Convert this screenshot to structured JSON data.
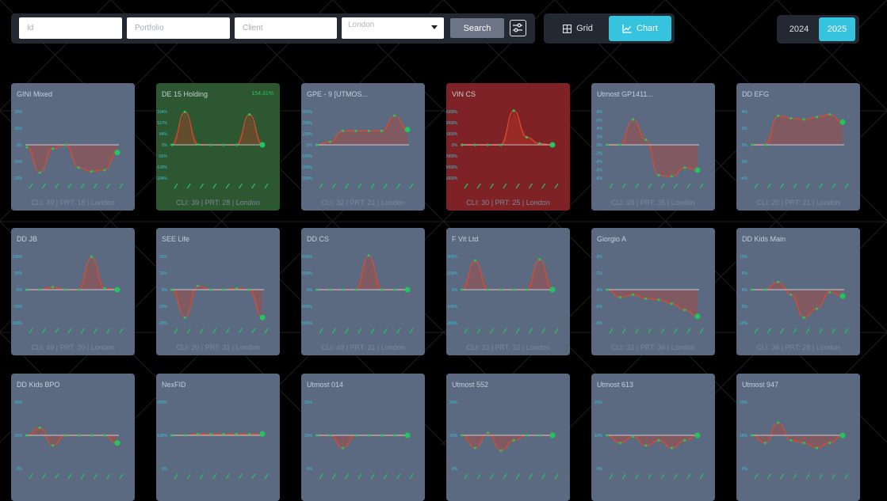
{
  "filters": {
    "id_placeholder": "Id",
    "portfolio_placeholder": "Portfolio",
    "client_placeholder": "Client",
    "location_value": "London",
    "search_label": "Search"
  },
  "view_toggle": {
    "grid_label": "Grid",
    "chart_label": "Chart",
    "active": "chart"
  },
  "year_toggle": {
    "years": [
      "2024",
      "2025"
    ],
    "active": "2025"
  },
  "colors": {
    "accent": "#36c3dd",
    "card_default": "#5b6a80",
    "card_positive": "#2c5730",
    "card_negative": "#7e2226",
    "line": "#e24a2b",
    "point": "#22c55e"
  },
  "cards": [
    {
      "title": "GINI Mixed",
      "perf": "",
      "footer": "CLI: 49 | PRT: 18 | London",
      "status": "neutral",
      "y_ticks": [
        "20%",
        "10%",
        "0%",
        "-10%",
        "-20%"
      ],
      "values": [
        -0.1,
        -1.1,
        -0.15,
        0,
        -0.9,
        -1.05,
        -1.0,
        -0.3
      ]
    },
    {
      "title": "DE 15 Holding",
      "perf": "154.31%",
      "footer": "CLI: 39 | PRT: 28 | London",
      "status": "positive",
      "y_ticks": [
        "334%",
        "167%",
        "84%",
        "0%",
        "-50%",
        "-100%",
        "-334%"
      ],
      "values": [
        0,
        1.3,
        0.01,
        0,
        0,
        0,
        1.2,
        0
      ]
    },
    {
      "title": "GPE - 9 [UTMOS...",
      "perf": "",
      "footer": "CLI: 32 | PRT: 21 | London",
      "status": "neutral",
      "y_ticks": [
        "300%",
        "200%",
        "100%",
        "0%",
        "-100%",
        "-200%",
        "-300%"
      ],
      "values": [
        0,
        0.12,
        0.55,
        0.55,
        0.55,
        0.55,
        1.15,
        0.6
      ]
    },
    {
      "title": "VIN CS",
      "perf": "",
      "footer": "CLI: 30 | PRT: 25 | London",
      "status": "negative",
      "y_ticks": [
        "6000%",
        "4000%",
        "2000%",
        "0%",
        "-2000%",
        "-4000%",
        "-6000%"
      ],
      "values": [
        0,
        0,
        0,
        0,
        1.35,
        0.3,
        0.05,
        0
      ]
    },
    {
      "title": "Utmost GP1411...",
      "perf": "",
      "footer": "CLI: 28 | PRT: 35 | London",
      "status": "neutral",
      "y_ticks": [
        "8%",
        "6%",
        "4%",
        "2%",
        "0%",
        "-2%",
        "-4%",
        "-6%",
        "-8%"
      ],
      "values": [
        0,
        0,
        1.0,
        0.2,
        -1.2,
        -1.25,
        -0.9,
        -1.0
      ]
    },
    {
      "title": "DD EFG",
      "perf": "",
      "footer": "CLI: 20 | PRT: 21 | London",
      "status": "neutral",
      "y_ticks": [
        "4%",
        "2%",
        "0%",
        "-2%",
        "-4%"
      ],
      "values": [
        0,
        0,
        1.15,
        1.05,
        1.0,
        1.1,
        1.2,
        0.9
      ]
    },
    {
      "title": "DD JB",
      "perf": "",
      "footer": "CLI: 49 | PRT: 30 | London",
      "status": "neutral",
      "y_ticks": [
        "100%",
        "50%",
        "0%",
        "-50%",
        "-100%"
      ],
      "values": [
        0,
        0,
        0.1,
        0,
        0,
        1.3,
        0.05,
        0
      ]
    },
    {
      "title": "SEE Life",
      "perf": "",
      "footer": "CLI: 20 | PRT: 31 | London",
      "status": "neutral",
      "y_ticks": [
        "20%",
        "10%",
        "0%",
        "-10%",
        "-20%"
      ],
      "values": [
        0,
        -1.1,
        0.15,
        0,
        0,
        0.05,
        0,
        -1.1
      ]
    },
    {
      "title": "DD CS",
      "perf": "",
      "footer": "CLI: 49 | PRT: 31 | London",
      "status": "neutral",
      "y_ticks": [
        "2000%",
        "1000%",
        "0%",
        "-1000%",
        "-2000%"
      ],
      "values": [
        0,
        0,
        0,
        0,
        1.35,
        0,
        0,
        0
      ]
    },
    {
      "title": "F Vit Ltd",
      "perf": "",
      "footer": "CLI: 33 | PRT: 32 | London",
      "status": "neutral",
      "y_ticks": [
        "200%",
        "100%",
        "0%",
        "-100%",
        "-200%"
      ],
      "values": [
        0,
        1.15,
        0,
        0,
        0,
        0,
        1.2,
        0
      ]
    },
    {
      "title": "Giorgio A",
      "perf": "",
      "footer": "CLI: 32 | PRT: 36 | London",
      "status": "neutral",
      "y_ticks": [
        "0%",
        "-2%",
        "-4%",
        "-6%",
        "-8%"
      ],
      "values": [
        0,
        -0.3,
        -0.2,
        -0.35,
        -0.4,
        -0.55,
        -0.8,
        -1.05
      ]
    },
    {
      "title": "DD Kids Main",
      "perf": "",
      "footer": "CLI: 36 | PRT: 28 | London",
      "status": "neutral",
      "y_ticks": [
        "10%",
        "5%",
        "0%",
        "-5%",
        "-10%"
      ],
      "values": [
        0,
        0,
        0.3,
        -0.2,
        -1.1,
        -0.75,
        -0.1,
        -0.25
      ]
    },
    {
      "title": "DD Kids BPO",
      "perf": "",
      "footer": "",
      "status": "neutral",
      "y_ticks": [
        "20%",
        "10%",
        "0%"
      ],
      "values": [
        0,
        0.3,
        -0.4,
        0,
        0,
        0,
        0,
        -0.3
      ]
    },
    {
      "title": "NexFID",
      "perf": "",
      "footer": "",
      "status": "neutral",
      "y_ticks": [
        "200%",
        "100%",
        "0%"
      ],
      "values": [
        0,
        0,
        0.05,
        0.05,
        0.05,
        0.05,
        0.05,
        0.05
      ]
    },
    {
      "title": "Utmost 014",
      "perf": "",
      "footer": "",
      "status": "neutral",
      "y_ticks": [
        "20%",
        "10%",
        "0%"
      ],
      "values": [
        0,
        0,
        -0.5,
        0,
        0,
        0,
        0,
        0
      ]
    },
    {
      "title": "Utmost 552",
      "perf": "",
      "footer": "",
      "status": "neutral",
      "y_ticks": [
        "20%",
        "10%",
        "0%"
      ],
      "values": [
        0,
        -0.5,
        0.1,
        -0.6,
        -0.2,
        0,
        0,
        0
      ]
    },
    {
      "title": "Utmost 613",
      "perf": "",
      "footer": "",
      "status": "neutral",
      "y_ticks": [
        "20%",
        "10%",
        "0%"
      ],
      "values": [
        0,
        -0.3,
        -0.05,
        -0.4,
        -0.2,
        -0.5,
        -0.2,
        0
      ]
    },
    {
      "title": "Utmost 947",
      "perf": "",
      "footer": "",
      "status": "neutral",
      "y_ticks": [
        "20%",
        "10%",
        "0%"
      ],
      "values": [
        0,
        -0.3,
        0.5,
        -0.2,
        -0.3,
        -0.5,
        -0.3,
        0
      ]
    }
  ]
}
